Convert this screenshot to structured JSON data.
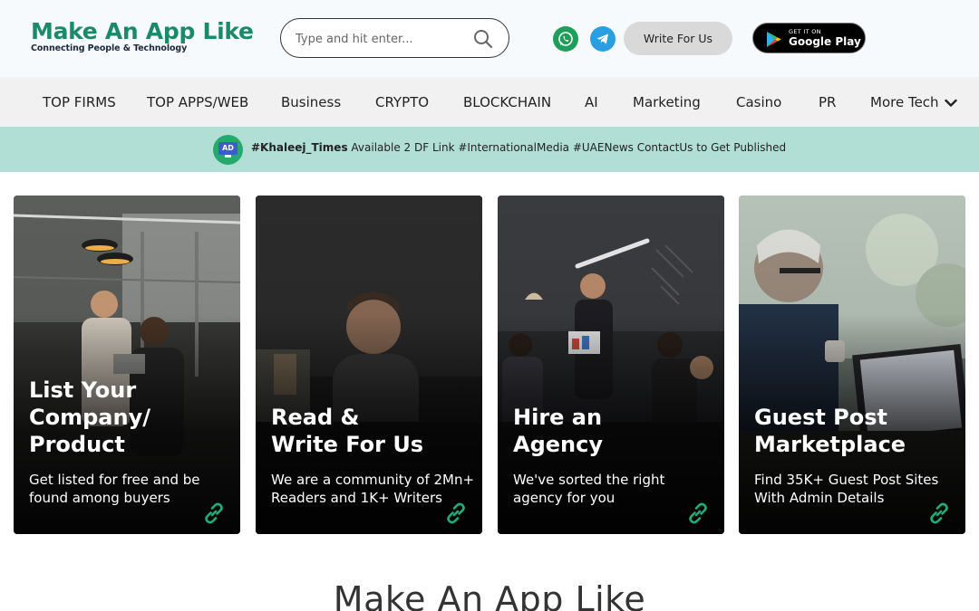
{
  "header": {
    "logo_title": "Make An App Like",
    "logo_tagline": "Connecting People & Technology",
    "search_placeholder": "Type and hit enter...",
    "write_button": "Write For Us",
    "google_play_small": "GET IT ON",
    "google_play_big": "Google Play"
  },
  "nav": {
    "items": [
      "TOP FIRMS",
      "TOP APPS/WEB",
      "Business",
      "CRYPTO",
      "BLOCKCHAIN",
      "AI",
      "Marketing",
      "Casino",
      "PR",
      "More Tech"
    ]
  },
  "ad": {
    "badge": "AD",
    "hashtag": "#Khaleej_Times",
    "text": " Available 2 DF Link #InternationalMedia #UAENews ContactUs to Get Published"
  },
  "cards": [
    {
      "title": "List Your\nCompany/\nProduct",
      "desc": "Get listed for free and be\nfound among buyers"
    },
    {
      "title": "Read &\nWrite For Us",
      "desc": "We are a community of 2Mn+\nReaders and 1K+ Writers"
    },
    {
      "title": "Hire an\nAgency",
      "desc": "We've sorted the right\nagency for you"
    },
    {
      "title": "Guest Post\nMarketplace",
      "desc": "Find 35K+ Guest Post Sites\nWith Admin Details"
    }
  ],
  "section": {
    "title": "Make An App Like"
  },
  "colors": {
    "brand_green": "#1a8a68",
    "ad_bar": "#b1dfd5",
    "link_icon": "#1fae7a",
    "whatsapp": "#1e9e5b",
    "telegram": "#2a9ee0"
  },
  "icons": [
    "search-icon",
    "whatsapp-icon",
    "telegram-icon",
    "google-play-icon",
    "chevron-down-icon",
    "ad-icon",
    "link-icon"
  ]
}
